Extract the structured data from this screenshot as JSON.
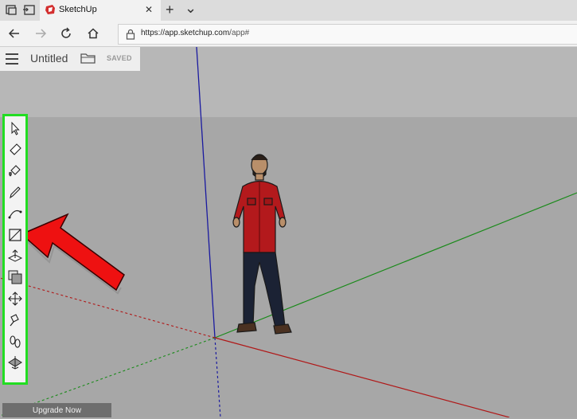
{
  "browser": {
    "tab_title": "SketchUp",
    "tab_close": "✕",
    "new_tab": "+",
    "tab_list": "⌄",
    "url_scheme_host": "https://app.sketchup.com",
    "url_path": "/app#"
  },
  "app": {
    "doc_title": "Untitled",
    "save_status": "SAVED",
    "upgrade_label": "Upgrade Now"
  },
  "toolbar": {
    "tools": [
      "select",
      "eraser",
      "paint-bucket",
      "pencil",
      "arc",
      "rectangle",
      "push-pull",
      "offset",
      "move",
      "tape-measure",
      "orbit",
      "section"
    ],
    "highlight_color": "#22dd22"
  },
  "annotation": {
    "arrow_color": "#ee1111"
  }
}
